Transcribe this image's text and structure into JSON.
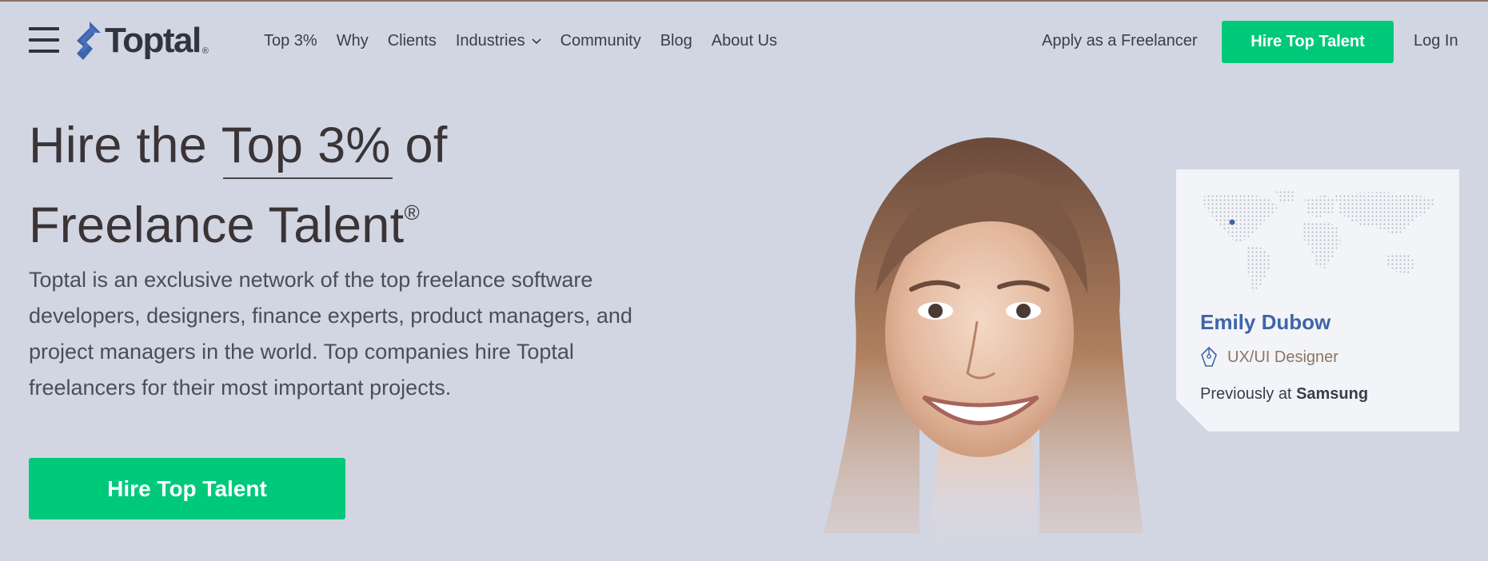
{
  "brand": {
    "name": "Toptal",
    "reg_mark": "®",
    "accent_color": "#00c97a",
    "link_color": "#3f64a8"
  },
  "nav": {
    "items": [
      {
        "label": "Top 3%"
      },
      {
        "label": "Why"
      },
      {
        "label": "Clients"
      },
      {
        "label": "Industries",
        "has_dropdown": true
      },
      {
        "label": "Community"
      },
      {
        "label": "Blog"
      },
      {
        "label": "About Us"
      }
    ],
    "apply_label": "Apply as a Freelancer",
    "hire_label": "Hire Top Talent",
    "login_label": "Log In",
    "menu_icon": "hamburger-icon"
  },
  "hero": {
    "title_part1": "Hire the ",
    "title_highlight": "Top 3%",
    "title_part2": " of",
    "title_line2": "Freelance Talent",
    "title_reg": "®",
    "description": "Toptal is an exclusive network of the top freelance software developers, designers, finance experts, product managers, and project managers in the world. Top companies hire Toptal freelancers for their most important projects.",
    "cta_label": "Hire Top Talent"
  },
  "profile_card": {
    "name": "Emily Dubow",
    "role": "UX/UI Designer",
    "role_icon": "pen-nib-icon",
    "previously_prefix": "Previously at ",
    "previously_company": "Samsung",
    "map_icon": "world-map-dots"
  }
}
